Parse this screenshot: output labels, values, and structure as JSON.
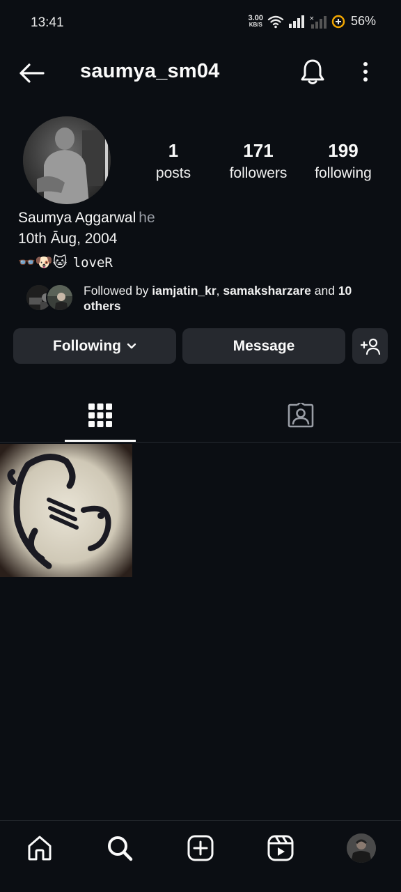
{
  "status_bar": {
    "time": "13:41",
    "net_speed_value": "3.00",
    "net_speed_unit": "KB/S",
    "battery": "56%"
  },
  "header": {
    "username": "saumya_sm04",
    "back_icon": "arrow-left-icon",
    "bell_icon": "bell-icon",
    "more_icon": "more-vertical-icon"
  },
  "profile": {
    "stats": [
      {
        "value": "1",
        "label": "posts"
      },
      {
        "value": "171",
        "label": "followers"
      },
      {
        "value": "199",
        "label": "following"
      }
    ],
    "full_name": "Saumya Aggarwal",
    "pronouns": "he",
    "bio_line1": "10th Āug, 2004",
    "bio_emojis": "👓🐶🐱",
    "bio_line2": "loveR"
  },
  "mutuals": {
    "prefix": "Followed by ",
    "user1": "iamjatin_kr",
    "separator": ", ",
    "user2": "samaksharzare",
    "and_text": " and ",
    "others": "10 others"
  },
  "actions": {
    "following_label": "Following",
    "message_label": "Message",
    "add_user_icon": "add-person-icon"
  },
  "tabs": {
    "grid_icon": "grid-icon",
    "tagged_icon": "tagged-person-icon"
  },
  "bottom_nav": {
    "items": [
      "home-icon",
      "search-icon",
      "create-post-icon",
      "reels-icon",
      "profile-avatar"
    ]
  },
  "colors": {
    "background": "#0b0e13",
    "button": "#26292f",
    "text": "#fafafa",
    "muted": "#9a9ea6"
  }
}
